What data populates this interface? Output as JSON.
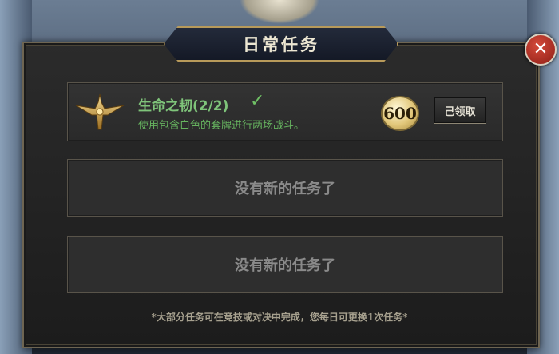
{
  "dialog": {
    "title": "日常任务",
    "close_glyph": "✕"
  },
  "tasks": [
    {
      "name": "生命之韧(2/2)",
      "status_icon": "check-icon",
      "description": "使用包含白色的套牌进行两场战斗。",
      "reward_value": "600",
      "reward_icon": "gold-coin-icon",
      "button_label": "己领取"
    }
  ],
  "empty_slots": [
    {
      "label": "没有新的任务了"
    },
    {
      "label": "没有新的任务了"
    }
  ],
  "footer_note": "*大部分任务可在竞技或对决中完成，您每日可更换1次任务*",
  "colors": {
    "task_name": "#7fc47a",
    "task_desc": "#66b35f",
    "gold_border": "#b89a5a",
    "close_red": "#c0392b"
  }
}
